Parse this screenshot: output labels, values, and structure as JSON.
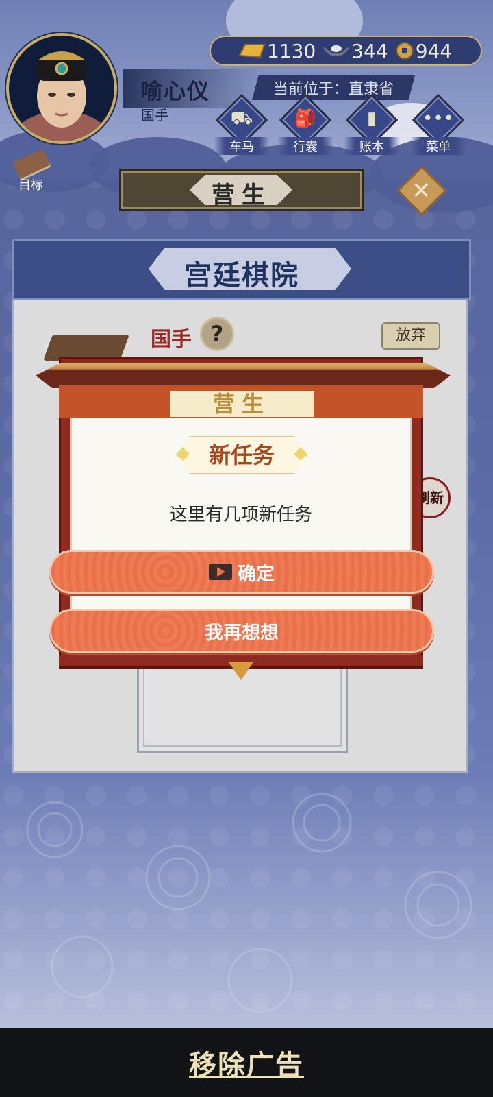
{
  "player": {
    "name": "喻心仪",
    "rank_title": "国手"
  },
  "currency": {
    "gold": "1130",
    "silver": "344",
    "coins": "944"
  },
  "location": "当前位于：直隶省",
  "nav": [
    {
      "label": "车马",
      "icon": "carriage-icon"
    },
    {
      "label": "行囊",
      "icon": "bag-icon"
    },
    {
      "label": "账本",
      "icon": "ledger-icon"
    },
    {
      "label": "菜单",
      "icon": "menu-dots-icon"
    }
  ],
  "goal_label": "目标",
  "section_banner": "营生",
  "panel": {
    "title": "宫廷棋院",
    "rank": "国手",
    "help": "?",
    "abandon": "放弃",
    "refresh": "刷新"
  },
  "dialog": {
    "header": "营生",
    "tag": "新任务",
    "message": "这里有几项新任务",
    "confirm": "确定",
    "reconsider": "我再想想"
  },
  "ad": {
    "remove": "移除广告"
  },
  "colors": {
    "accent_red": "#e8704a",
    "panel_blue": "#3b4f86",
    "frame_red": "#8e2a1e",
    "gold_text": "#ece1b8"
  }
}
